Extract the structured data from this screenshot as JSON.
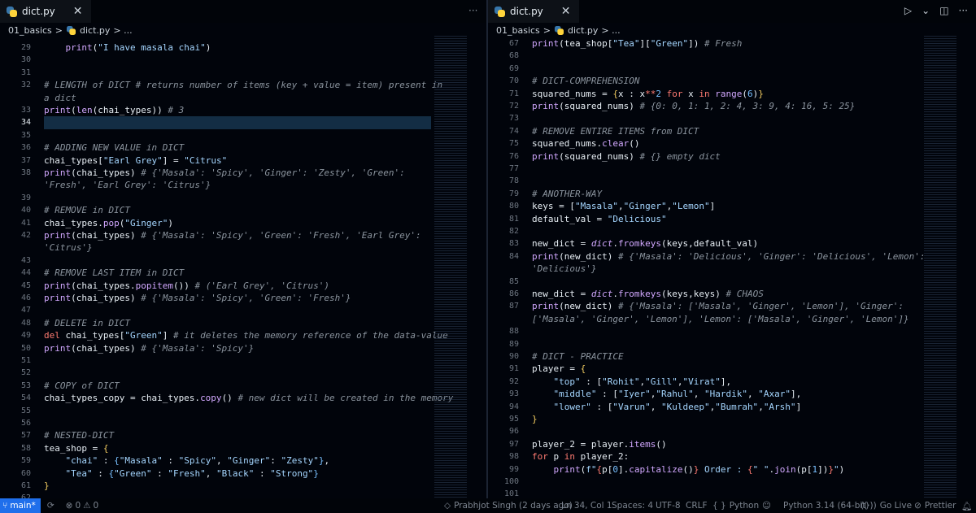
{
  "left": {
    "tab_title": "dict.py",
    "close": "✕",
    "breadcrumb": {
      "folder": "01_basics",
      "sep": ">",
      "file": "dict.py",
      "more": "> ..."
    },
    "lines": [
      {
        "n": "29",
        "t": [
          [
            "    ",
            "v"
          ],
          [
            "print",
            "f"
          ],
          [
            "(",
            "v"
          ],
          [
            "\"I have masala chai\"",
            "s"
          ],
          [
            ")",
            "v"
          ]
        ]
      },
      {
        "n": "30",
        "t": []
      },
      {
        "n": "31",
        "t": []
      },
      {
        "n": "32",
        "t": [
          [
            "# LENGTH of DICT # returns number of items (key + value = item) present in",
            "c"
          ]
        ]
      },
      {
        "n": "",
        "t": [
          [
            "a dict",
            "c"
          ]
        ]
      },
      {
        "n": "33",
        "t": [
          [
            "print",
            "f"
          ],
          [
            "(",
            "v"
          ],
          [
            "len",
            "f"
          ],
          [
            "(chai_types)) ",
            "v"
          ],
          [
            "# 3",
            "c"
          ]
        ]
      },
      {
        "n": "34",
        "cur": true,
        "t": []
      },
      {
        "n": "35",
        "t": []
      },
      {
        "n": "36",
        "t": [
          [
            "# ADDING NEW VALUE in DICT",
            "c"
          ]
        ]
      },
      {
        "n": "37",
        "t": [
          [
            "chai_types[",
            "v"
          ],
          [
            "\"Earl Grey\"",
            "s"
          ],
          [
            "] = ",
            "v"
          ],
          [
            "\"Citrus\"",
            "s"
          ]
        ]
      },
      {
        "n": "38",
        "t": [
          [
            "print",
            "f"
          ],
          [
            "(chai_types) ",
            "v"
          ],
          [
            "# {'Masala': 'Spicy', 'Ginger': 'Zesty', 'Green':",
            "c"
          ]
        ]
      },
      {
        "n": "",
        "t": [
          [
            "'Fresh', 'Earl Grey': 'Citrus'}",
            "c"
          ]
        ]
      },
      {
        "n": "39",
        "t": []
      },
      {
        "n": "40",
        "t": [
          [
            "# REMOVE in DICT",
            "c"
          ]
        ]
      },
      {
        "n": "41",
        "t": [
          [
            "chai_types.",
            "v"
          ],
          [
            "pop",
            "f"
          ],
          [
            "(",
            "v"
          ],
          [
            "\"Ginger\"",
            "s"
          ],
          [
            ")",
            "v"
          ]
        ]
      },
      {
        "n": "42",
        "t": [
          [
            "print",
            "f"
          ],
          [
            "(chai_types) ",
            "v"
          ],
          [
            "# {'Masala': 'Spicy', 'Green': 'Fresh', 'Earl Grey':",
            "c"
          ]
        ]
      },
      {
        "n": "",
        "t": [
          [
            "'Citrus'}",
            "c"
          ]
        ]
      },
      {
        "n": "43",
        "t": []
      },
      {
        "n": "44",
        "t": [
          [
            "# REMOVE LAST ITEM in DICT",
            "c"
          ]
        ]
      },
      {
        "n": "45",
        "t": [
          [
            "print",
            "f"
          ],
          [
            "(chai_types.",
            "v"
          ],
          [
            "popitem",
            "f"
          ],
          [
            "()) ",
            "v"
          ],
          [
            "# ('Earl Grey', 'Citrus')",
            "c"
          ]
        ]
      },
      {
        "n": "46",
        "t": [
          [
            "print",
            "f"
          ],
          [
            "(chai_types) ",
            "v"
          ],
          [
            "# {'Masala': 'Spicy', 'Green': 'Fresh'}",
            "c"
          ]
        ]
      },
      {
        "n": "47",
        "t": []
      },
      {
        "n": "48",
        "t": [
          [
            "# DELETE in DICT",
            "c"
          ]
        ]
      },
      {
        "n": "49",
        "t": [
          [
            "del",
            "k"
          ],
          [
            " chai_types[",
            "v"
          ],
          [
            "\"Green\"",
            "s"
          ],
          [
            "] ",
            "v"
          ],
          [
            "# it deletes the memory reference of the data-value",
            "c"
          ]
        ]
      },
      {
        "n": "50",
        "t": [
          [
            "print",
            "f"
          ],
          [
            "(chai_types) ",
            "v"
          ],
          [
            "# {'Masala': 'Spicy'}",
            "c"
          ]
        ]
      },
      {
        "n": "51",
        "t": []
      },
      {
        "n": "52",
        "t": []
      },
      {
        "n": "53",
        "t": [
          [
            "# COPY of DICT",
            "c"
          ]
        ]
      },
      {
        "n": "54",
        "t": [
          [
            "chai_types_copy = chai_types.",
            "v"
          ],
          [
            "copy",
            "f"
          ],
          [
            "() ",
            "v"
          ],
          [
            "# new dict will be created in the memory",
            "c"
          ]
        ]
      },
      {
        "n": "55",
        "t": []
      },
      {
        "n": "56",
        "t": []
      },
      {
        "n": "57",
        "t": [
          [
            "# NESTED-DICT",
            "c"
          ]
        ]
      },
      {
        "n": "58",
        "t": [
          [
            "tea_shop = ",
            "v"
          ],
          [
            "{",
            "p"
          ]
        ]
      },
      {
        "n": "59",
        "t": [
          [
            "    ",
            "v"
          ],
          [
            "\"chai\"",
            "s"
          ],
          [
            " : ",
            "v"
          ],
          [
            "{",
            "b"
          ],
          [
            "\"Masala\"",
            "s"
          ],
          [
            " : ",
            "v"
          ],
          [
            "\"Spicy\"",
            "s"
          ],
          [
            ", ",
            "v"
          ],
          [
            "\"Ginger\"",
            "s"
          ],
          [
            ": ",
            "v"
          ],
          [
            "\"Zesty\"",
            "s"
          ],
          [
            "}",
            "b"
          ],
          [
            ",",
            "v"
          ]
        ]
      },
      {
        "n": "60",
        "t": [
          [
            "    ",
            "v"
          ],
          [
            "\"Tea\"",
            "s"
          ],
          [
            " : ",
            "v"
          ],
          [
            "{",
            "b"
          ],
          [
            "\"Green\"",
            "s"
          ],
          [
            " : ",
            "v"
          ],
          [
            "\"Fresh\"",
            "s"
          ],
          [
            ", ",
            "v"
          ],
          [
            "\"Black\"",
            "s"
          ],
          [
            " : ",
            "v"
          ],
          [
            "\"Strong\"",
            "s"
          ],
          [
            "}",
            "b"
          ]
        ]
      },
      {
        "n": "61",
        "t": [
          [
            "}",
            "p"
          ]
        ]
      },
      {
        "n": "62",
        "t": []
      }
    ]
  },
  "right": {
    "tab_title": "dict.py",
    "close": "✕",
    "breadcrumb": {
      "folder": "01_basics",
      "sep": ">",
      "file": "dict.py",
      "more": "> ..."
    },
    "lines": [
      {
        "n": "67",
        "t": [
          [
            "print",
            "f"
          ],
          [
            "(tea_shop[",
            "v"
          ],
          [
            "\"Tea\"",
            "s"
          ],
          [
            "][",
            "v"
          ],
          [
            "\"Green\"",
            "s"
          ],
          [
            "]) ",
            "v"
          ],
          [
            "# Fresh",
            "c"
          ]
        ]
      },
      {
        "n": "68",
        "t": []
      },
      {
        "n": "69",
        "t": []
      },
      {
        "n": "70",
        "t": [
          [
            "# DICT-COMPREHENSION",
            "c"
          ]
        ]
      },
      {
        "n": "71",
        "t": [
          [
            "squared_nums = ",
            "v"
          ],
          [
            "{",
            "p"
          ],
          [
            "x : x",
            "v"
          ],
          [
            "**",
            "o"
          ],
          [
            "2",
            "n"
          ],
          [
            " ",
            "v"
          ],
          [
            "for",
            "k"
          ],
          [
            " x ",
            "v"
          ],
          [
            "in",
            "k"
          ],
          [
            " ",
            "v"
          ],
          [
            "range",
            "f"
          ],
          [
            "(",
            "v"
          ],
          [
            "6",
            "n"
          ],
          [
            ")",
            "v"
          ],
          [
            "}",
            "p"
          ]
        ]
      },
      {
        "n": "72",
        "t": [
          [
            "print",
            "f"
          ],
          [
            "(squared_nums) ",
            "v"
          ],
          [
            "# {0: 0, 1: 1, 2: 4, 3: 9, 4: 16, 5: 25}",
            "c"
          ]
        ]
      },
      {
        "n": "73",
        "t": []
      },
      {
        "n": "74",
        "t": [
          [
            "# REMOVE ENTIRE ITEMS from DICT",
            "c"
          ]
        ]
      },
      {
        "n": "75",
        "t": [
          [
            "squared_nums.",
            "v"
          ],
          [
            "clear",
            "f"
          ],
          [
            "()",
            "v"
          ]
        ]
      },
      {
        "n": "76",
        "t": [
          [
            "print",
            "f"
          ],
          [
            "(squared_nums) ",
            "v"
          ],
          [
            "# {} empty dict",
            "c"
          ]
        ]
      },
      {
        "n": "77",
        "t": []
      },
      {
        "n": "78",
        "t": []
      },
      {
        "n": "79",
        "t": [
          [
            "# ANOTHER-WAY",
            "c"
          ]
        ]
      },
      {
        "n": "80",
        "t": [
          [
            "keys = [",
            "v"
          ],
          [
            "\"Masala\"",
            "s"
          ],
          [
            ",",
            "v"
          ],
          [
            "\"Ginger\"",
            "s"
          ],
          [
            ",",
            "v"
          ],
          [
            "\"Lemon\"",
            "s"
          ],
          [
            "]",
            "v"
          ]
        ]
      },
      {
        "n": "81",
        "t": [
          [
            "default_val = ",
            "v"
          ],
          [
            "\"Delicious\"",
            "s"
          ]
        ]
      },
      {
        "n": "82",
        "t": []
      },
      {
        "n": "83",
        "t": [
          [
            "new_dict = ",
            "v"
          ],
          [
            "dict",
            "i"
          ],
          [
            ".",
            "v"
          ],
          [
            "fromkeys",
            "f"
          ],
          [
            "(keys,default_val)",
            "v"
          ]
        ]
      },
      {
        "n": "84",
        "t": [
          [
            "print",
            "f"
          ],
          [
            "(new_dict) ",
            "v"
          ],
          [
            "# {'Masala': 'Delicious', 'Ginger': 'Delicious', 'Lemon':",
            "c"
          ]
        ]
      },
      {
        "n": "",
        "t": [
          [
            "'Delicious'}",
            "c"
          ]
        ]
      },
      {
        "n": "85",
        "t": []
      },
      {
        "n": "86",
        "t": [
          [
            "new_dict = ",
            "v"
          ],
          [
            "dict",
            "i"
          ],
          [
            ".",
            "v"
          ],
          [
            "fromkeys",
            "f"
          ],
          [
            "(keys,keys) ",
            "v"
          ],
          [
            "# CHAOS",
            "c"
          ]
        ]
      },
      {
        "n": "87",
        "t": [
          [
            "print",
            "f"
          ],
          [
            "(new_dict) ",
            "v"
          ],
          [
            "# {'Masala': ['Masala', 'Ginger', 'Lemon'], 'Ginger':",
            "c"
          ]
        ]
      },
      {
        "n": "",
        "t": [
          [
            "['Masala', 'Ginger', 'Lemon'], 'Lemon': ['Masala', 'Ginger', 'Lemon']}",
            "c"
          ]
        ]
      },
      {
        "n": "88",
        "t": []
      },
      {
        "n": "89",
        "t": []
      },
      {
        "n": "90",
        "t": [
          [
            "# DICT - PRACTICE",
            "c"
          ]
        ]
      },
      {
        "n": "91",
        "t": [
          [
            "player = ",
            "v"
          ],
          [
            "{",
            "p"
          ]
        ]
      },
      {
        "n": "92",
        "t": [
          [
            "    ",
            "v"
          ],
          [
            "\"top\"",
            "s"
          ],
          [
            " : [",
            "v"
          ],
          [
            "\"Rohit\"",
            "s"
          ],
          [
            ",",
            "v"
          ],
          [
            "\"Gill\"",
            "s"
          ],
          [
            ",",
            "v"
          ],
          [
            "\"Virat\"",
            "s"
          ],
          [
            "],",
            "v"
          ]
        ]
      },
      {
        "n": "93",
        "t": [
          [
            "    ",
            "v"
          ],
          [
            "\"middle\"",
            "s"
          ],
          [
            " : [",
            "v"
          ],
          [
            "\"Iyer\"",
            "s"
          ],
          [
            ",",
            "v"
          ],
          [
            "\"Rahul\"",
            "s"
          ],
          [
            ", ",
            "v"
          ],
          [
            "\"Hardik\"",
            "s"
          ],
          [
            ", ",
            "v"
          ],
          [
            "\"Axar\"",
            "s"
          ],
          [
            "],",
            "v"
          ]
        ]
      },
      {
        "n": "94",
        "t": [
          [
            "    ",
            "v"
          ],
          [
            "\"lower\"",
            "s"
          ],
          [
            " : [",
            "v"
          ],
          [
            "\"Varun\"",
            "s"
          ],
          [
            ", ",
            "v"
          ],
          [
            "\"Kuldeep\"",
            "s"
          ],
          [
            ",",
            "v"
          ],
          [
            "\"Bumrah\"",
            "s"
          ],
          [
            ",",
            "v"
          ],
          [
            "\"Arsh\"",
            "s"
          ],
          [
            "]",
            "v"
          ]
        ]
      },
      {
        "n": "95",
        "t": [
          [
            "}",
            "p"
          ]
        ]
      },
      {
        "n": "96",
        "t": []
      },
      {
        "n": "97",
        "t": [
          [
            "player_2 = player.",
            "v"
          ],
          [
            "items",
            "f"
          ],
          [
            "()",
            "v"
          ]
        ]
      },
      {
        "n": "98",
        "t": [
          [
            "for",
            "k"
          ],
          [
            " p ",
            "v"
          ],
          [
            "in",
            "k"
          ],
          [
            " player_2:",
            "v"
          ]
        ]
      },
      {
        "n": "99",
        "t": [
          [
            "    ",
            "v"
          ],
          [
            "print",
            "f"
          ],
          [
            "(",
            "v"
          ],
          [
            "f\"",
            "s"
          ],
          [
            "{",
            "k"
          ],
          [
            "p[",
            "v"
          ],
          [
            "0",
            "n"
          ],
          [
            "].",
            "v"
          ],
          [
            "capitalize",
            "f"
          ],
          [
            "()",
            "v"
          ],
          [
            "}",
            "k"
          ],
          [
            " Order : ",
            "s"
          ],
          [
            "{",
            "k"
          ],
          [
            "\" \"",
            "s"
          ],
          [
            ".",
            "v"
          ],
          [
            "join",
            "f"
          ],
          [
            "(p[",
            "v"
          ],
          [
            "1",
            "n"
          ],
          [
            "])",
            "v"
          ],
          [
            "}",
            "k"
          ],
          [
            "\"",
            "s"
          ],
          [
            ")",
            "v"
          ]
        ]
      },
      {
        "n": "100",
        "t": []
      },
      {
        "n": "101",
        "t": []
      }
    ]
  },
  "window_controls": {
    "run": "▷",
    "run_dropdown": "⌄",
    "split": "◫",
    "more": "···"
  },
  "tab_more_left": "···",
  "statusbar": {
    "branch": "main*",
    "sync_icon": "⟳",
    "errors": "0",
    "warnings": "0",
    "blame": "Prabhjot Singh (2 days ago)",
    "position": "Ln 34, Col 1",
    "spaces": "Spaces: 4",
    "encoding": "UTF-8",
    "eol": "CRLF",
    "language": "Python",
    "interpreter": "Python 3.14 (64-bit)",
    "golive": "Go Live",
    "prettier": "Prettier"
  }
}
